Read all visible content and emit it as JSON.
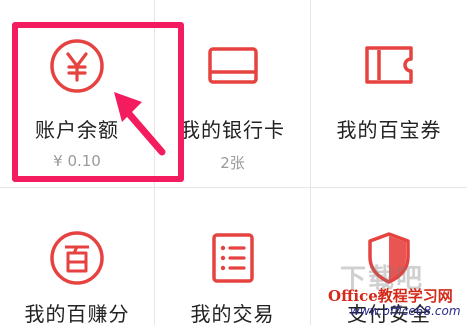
{
  "colors": {
    "accent": "#e64340",
    "highlight": "#f21c5f"
  },
  "items": [
    {
      "label": "账户余额",
      "sub": "¥ 0.10",
      "icon": "yen-circle-icon"
    },
    {
      "label": "我的银行卡",
      "sub": "2张",
      "icon": "bank-card-icon"
    },
    {
      "label": "我的百宝券",
      "sub": "",
      "icon": "coupon-ticket-icon"
    },
    {
      "label": "我的百赚分",
      "sub": "",
      "icon": "bai-circle-icon"
    },
    {
      "label": "我的交易",
      "sub": "",
      "icon": "transaction-list-icon"
    },
    {
      "label": "支付安全",
      "sub": "",
      "icon": "shield-icon"
    }
  ],
  "watermark": {
    "cn": "下载吧",
    "brand": "Office教程学习网",
    "url": "www.office68.com"
  }
}
